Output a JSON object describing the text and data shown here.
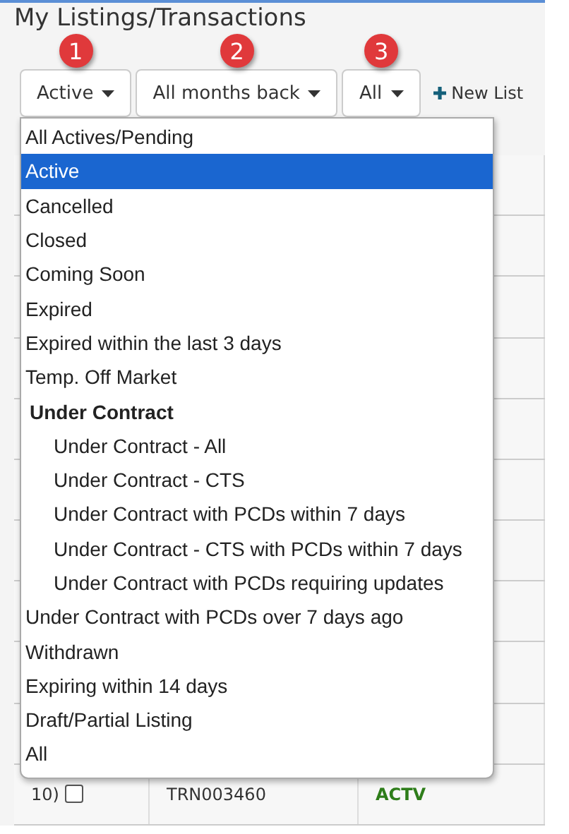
{
  "title": "My Listings/Transactions",
  "toolbar": [
    {
      "label": "Active",
      "badge": "1",
      "kind": "dropdown"
    },
    {
      "label": "All months back",
      "badge": "2",
      "kind": "dropdown"
    },
    {
      "label": "All",
      "badge": "3",
      "kind": "dropdown"
    },
    {
      "label": "New List",
      "kind": "action"
    }
  ],
  "menu": [
    {
      "label": "All Actives/Pending",
      "selected": false
    },
    {
      "label": "Active",
      "selected": true
    },
    {
      "label": "Cancelled",
      "selected": false
    },
    {
      "label": "Closed",
      "selected": false
    },
    {
      "label": "Coming Soon",
      "selected": false
    },
    {
      "label": "Expired",
      "selected": false
    },
    {
      "label": "Expired within the last 3 days",
      "selected": false
    },
    {
      "label": "Temp. Off Market",
      "selected": false
    },
    {
      "label": "Under Contract",
      "kind": "group",
      "children": [
        {
          "label": "Under Contract - All",
          "selected": false
        },
        {
          "label": "Under Contract - CTS",
          "selected": false
        },
        {
          "label": "Under Contract with PCDs within 7 days",
          "selected": false
        },
        {
          "label": "Under Contract - CTS with PCDs within 7 days",
          "selected": false
        },
        {
          "label": "Under Contract with PCDs requiring updates",
          "selected": false
        }
      ]
    },
    {
      "label": "Under Contract with PCDs over 7 days ago",
      "selected": false
    },
    {
      "label": "Withdrawn",
      "selected": false
    },
    {
      "label": "Expiring within 14 days",
      "selected": false
    },
    {
      "label": "Draft/Partial Listing",
      "selected": false
    },
    {
      "label": "All",
      "selected": false
    }
  ],
  "table": {
    "rows": [
      {
        "number": "10)",
        "checked": false,
        "transaction": "TRN003460",
        "status": "ACTV"
      }
    ]
  }
}
